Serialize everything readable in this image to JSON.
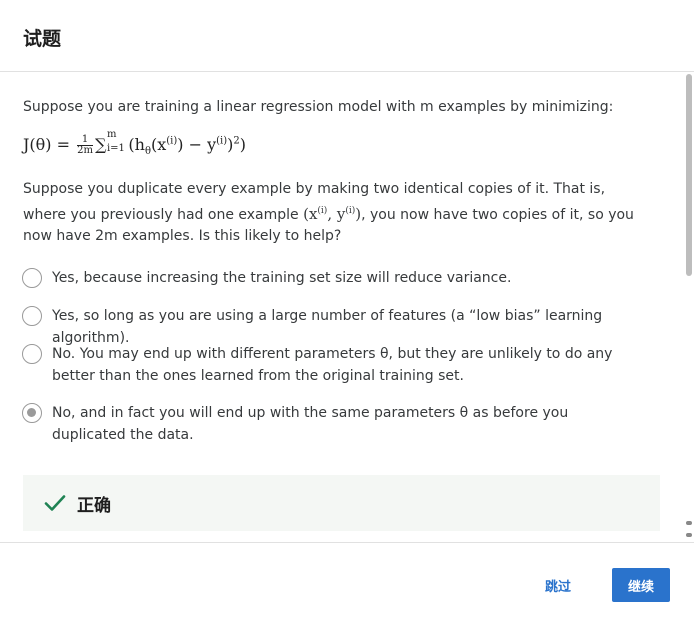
{
  "dialog": {
    "title": "试题"
  },
  "question": {
    "intro": "Suppose you are training a linear regression model with m examples by minimizing:",
    "formula": {
      "lhs": "J(θ) = ",
      "frac_num": "1",
      "frac_den": "2m",
      "sum_top": "m",
      "sum_bottom": "i=1",
      "body_open": "(h",
      "theta_sub": "θ",
      "x_open": "(x",
      "sup_i": "(i)",
      "minus_y": ") − y",
      "close": ")",
      "sq": "2",
      "end": ")"
    },
    "paragraph_part1": "Suppose you duplicate every example by making two identical copies of it. That is, where you previously had one example ",
    "paragraph_math": "(x",
    "paragraph_math_sup1": "(i)",
    "paragraph_math_mid": ", y",
    "paragraph_math_sup2": "(i)",
    "paragraph_math_end": ")",
    "paragraph_part2": ", you now have two copies of it, so you now have 2m examples. Is this likely to help?"
  },
  "options": [
    {
      "label": "Yes, because increasing the training set size will reduce variance.",
      "checked": false
    },
    {
      "label": "Yes, so long as you are using a large number of features (a “low bias” learning algorithm).",
      "checked": false
    },
    {
      "label": "No. You may end up with different parameters θ, but they are unlikely to do any better than the ones learned from the original training set.",
      "checked": false
    },
    {
      "label": "No, and in fact you will end up with the same parameters θ as before you duplicated the data.",
      "checked": true
    }
  ],
  "feedback": {
    "label": "正确",
    "icon": "check-icon",
    "color": "#1f8354"
  },
  "footer": {
    "skip_label": "跳过",
    "continue_label": "继续"
  },
  "colors": {
    "accent": "#2a73cc",
    "feedback_bg": "#f4f7f4"
  }
}
